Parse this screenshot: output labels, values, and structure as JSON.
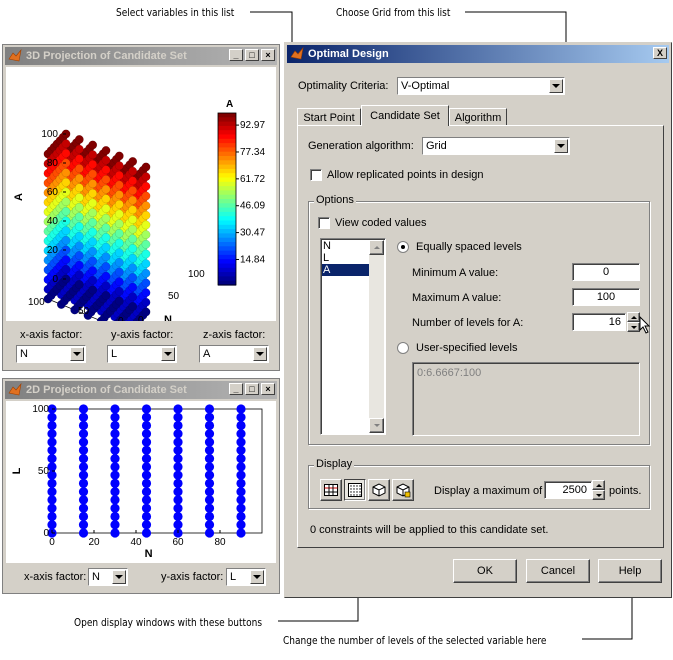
{
  "annotations": {
    "select_variables": "Select variables in this list",
    "choose_grid": "Choose Grid from this list",
    "open_display": "Open display windows with these buttons",
    "change_levels": "Change the number of levels of the selected variable here"
  },
  "win3d": {
    "title": "3D Projection of Candidate Set",
    "colorbar_label": "A",
    "colorbar_ticks": [
      "92.97",
      "77.34",
      "61.72",
      "46.09",
      "30.47",
      "14.84"
    ],
    "axis_A": "A",
    "axis_L": "L",
    "axis_N": "N",
    "z_ticks": [
      "100",
      "80",
      "60",
      "40",
      "20",
      "0"
    ],
    "l_ticks": [
      "100",
      "50",
      "0"
    ],
    "n_ticks": [
      "0",
      "50",
      "100"
    ],
    "x_factor_label": "x-axis factor:",
    "y_factor_label": "y-axis factor:",
    "z_factor_label": "z-axis factor:",
    "x_factor": "N",
    "y_factor": "L",
    "z_factor": "A"
  },
  "win2d": {
    "title": "2D Projection of Candidate Set",
    "ylabel": "L",
    "xlabel": "N",
    "y_ticks": [
      "100",
      "50",
      "0"
    ],
    "x_ticks": [
      "0",
      "20",
      "40",
      "60",
      "80"
    ],
    "x_factor_label": "x-axis factor:",
    "y_factor_label": "y-axis factor:",
    "x_factor": "N",
    "y_factor": "L"
  },
  "chart_data": [
    {
      "type": "scatter",
      "title": "",
      "xlabel": "N",
      "ylabel": "L",
      "zlabel": "A",
      "colorbar_ticks": [
        92.97,
        77.34,
        61.72,
        46.09,
        30.47,
        14.84
      ],
      "zlim": [
        0,
        100
      ]
    },
    {
      "type": "scatter",
      "title": "",
      "xlabel": "N",
      "ylabel": "L",
      "x": [
        0,
        15,
        30,
        45,
        60,
        75,
        90
      ],
      "xlim": [
        0,
        100
      ],
      "ylim": [
        0,
        100
      ]
    }
  ],
  "dialog": {
    "title": "Optimal Design",
    "close_label": "X",
    "optimality_label": "Optimality Criteria:",
    "optimality_value": "V-Optimal",
    "tabs": [
      "Start Point",
      "Candidate Set",
      "Algorithm"
    ],
    "generation_label": "Generation algorithm:",
    "generation_value": "Grid",
    "allow_replicated": "Allow replicated points in design",
    "options_label": "Options",
    "view_coded": "View coded values",
    "variables": [
      "N",
      "L",
      "A"
    ],
    "equally_spaced": "Equally spaced levels",
    "min_label": "Minimum A value:",
    "min_value": "0",
    "max_label": "Maximum A value:",
    "max_value": "100",
    "levels_label": "Number of levels for A:",
    "levels_value": "16",
    "user_specified": "User-specified levels",
    "user_levels_value": "0:6.6667:100",
    "display_label": "Display",
    "display_max_label": "Display a maximum of",
    "display_max_value": "2500",
    "points_label": "points.",
    "constraints_text": "0 constraints will be applied to this candidate set.",
    "ok": "OK",
    "cancel": "Cancel",
    "help": "Help"
  },
  "colors": {
    "selection": "#0a246a",
    "scatter_blue": "#0000ff"
  }
}
